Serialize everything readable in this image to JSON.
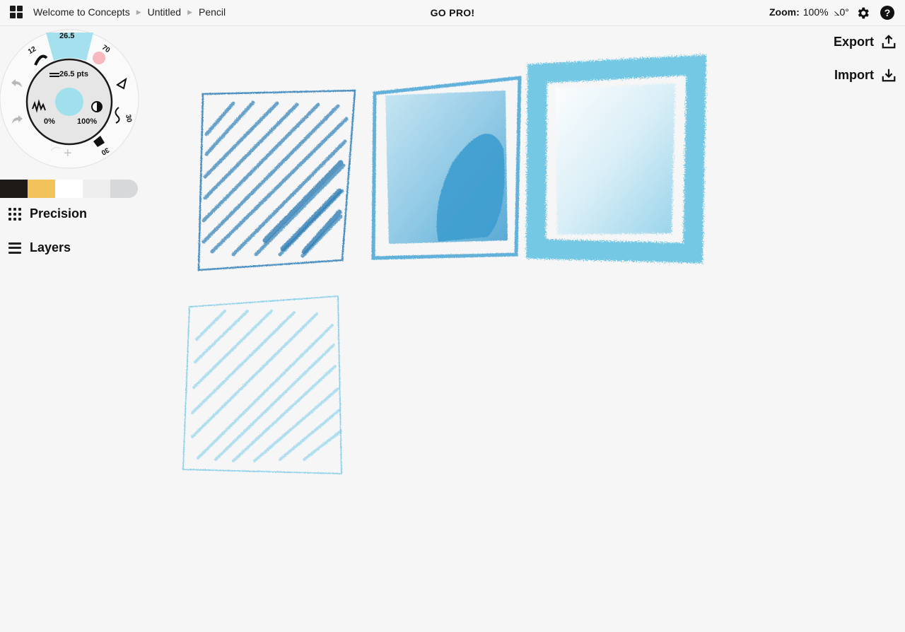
{
  "header": {
    "breadcrumbs": [
      "Welcome to Concepts",
      "Untitled",
      "Pencil"
    ],
    "promo": "GO PRO!",
    "zoom_label": "Zoom:",
    "zoom_value": "100%",
    "rotation": "⦣0°",
    "help_glyph": "?"
  },
  "actions": {
    "export": "Export",
    "import": "Import"
  },
  "tool_wheel": {
    "active_size": "26.5",
    "left_size": "12",
    "right_size": "70",
    "size_readout": "26.5 pts",
    "smoothing": "0%",
    "opacity": "100%",
    "right_tool_size": "30",
    "eraser_size": "30",
    "add_glyph": "+",
    "active_color": "#9fe0ec"
  },
  "palette": [
    "#1d1a17",
    "#f2c35b",
    "#ffffff",
    "#eeeeef",
    "#d6d8da"
  ],
  "menu": {
    "precision": "Precision",
    "layers": "Layers"
  },
  "icons": [
    "grid-icon",
    "gear-icon",
    "help-icon",
    "export-icon",
    "import-icon",
    "undo-icon",
    "redo-icon",
    "precision-grid-icon",
    "layers-icon"
  ]
}
